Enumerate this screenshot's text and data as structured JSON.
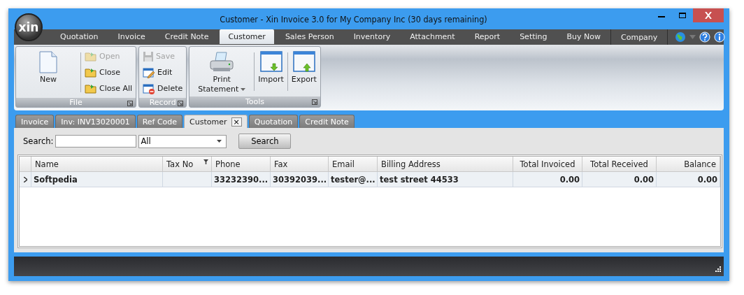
{
  "window": {
    "title": "Customer - Xin Invoice 3.0 for My Company Inc (30 days remaining)",
    "logo": "xin"
  },
  "menu_tabs": [
    {
      "label": "Quotation",
      "selected": false
    },
    {
      "label": "Invoice",
      "selected": false
    },
    {
      "label": "Credit Note",
      "selected": false
    },
    {
      "label": "Customer",
      "selected": true
    },
    {
      "label": "Sales Person",
      "selected": false
    },
    {
      "label": "Inventory",
      "selected": false
    },
    {
      "label": "Attachment",
      "selected": false
    },
    {
      "label": "Report",
      "selected": false
    },
    {
      "label": "Setting",
      "selected": false
    },
    {
      "label": "Buy Now",
      "selected": false
    },
    {
      "label": "Company",
      "selected": false
    }
  ],
  "ribbon": {
    "groups": [
      {
        "label": "File",
        "items": [
          {
            "label": "New",
            "kind": "large",
            "disabled": false
          },
          {
            "label": "Open",
            "kind": "small",
            "disabled": true
          },
          {
            "label": "Close",
            "kind": "small",
            "disabled": false
          },
          {
            "label": "Close All",
            "kind": "small",
            "disabled": false
          }
        ]
      },
      {
        "label": "Record",
        "items": [
          {
            "label": "Save",
            "kind": "small",
            "disabled": true
          },
          {
            "label": "Edit",
            "kind": "small",
            "disabled": false
          },
          {
            "label": "Delete",
            "kind": "small",
            "disabled": false
          }
        ]
      },
      {
        "label": "Tools",
        "items": [
          {
            "label": "Print Statement",
            "kind": "large",
            "dropdown": true,
            "disabled": false
          },
          {
            "label": "Import",
            "kind": "large",
            "disabled": false
          },
          {
            "label": "Export",
            "kind": "large",
            "disabled": false
          }
        ]
      }
    ]
  },
  "doc_tabs": [
    {
      "label": "Invoice",
      "selected": false
    },
    {
      "label": "Inv: INV13020001",
      "selected": false
    },
    {
      "label": "Ref Code",
      "selected": false
    },
    {
      "label": "Customer",
      "selected": true,
      "close": "×"
    },
    {
      "label": "Quotation",
      "selected": false
    },
    {
      "label": "Credit Note",
      "selected": false
    }
  ],
  "search": {
    "label": "Search:",
    "filter": "All",
    "button": "Search"
  },
  "table": {
    "columns": [
      {
        "label": "Name"
      },
      {
        "label": "Tax No",
        "filter": true
      },
      {
        "label": "Phone"
      },
      {
        "label": "Fax"
      },
      {
        "label": "Email"
      },
      {
        "label": "Billing Address"
      },
      {
        "label": "Total Invoiced"
      },
      {
        "label": "Total Received"
      },
      {
        "label": "Balance"
      }
    ],
    "rows": [
      {
        "selected": true,
        "cells": [
          "Softpedia",
          "",
          "33232390...",
          "30392039...",
          "tester@...",
          "test street 44533",
          "0.00",
          "0.00",
          "0.00"
        ]
      }
    ]
  }
}
